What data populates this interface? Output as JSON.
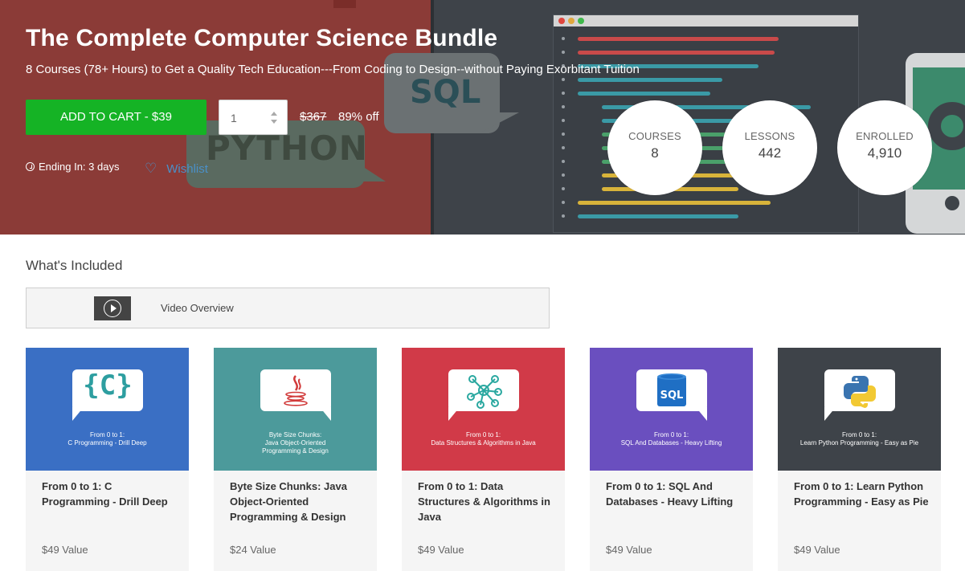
{
  "hero": {
    "title": "The Complete Computer Science Bundle",
    "subtitle": "8 Courses (78+ Hours) to Get a Quality Tech Education---From Coding to Design--without Paying Exorbitant Tuition",
    "cart_label": "ADD TO CART - $39",
    "quantity": "1",
    "old_price": "$367",
    "discount": "89% off",
    "ending": "Ending In: 3 days",
    "wishlist": "Wishlist",
    "bg_text_sql": "SQL",
    "bg_text_python": "PYTHON",
    "colors": {
      "hero_bg": "#8b3b37",
      "cart": "#15b325",
      "wishlist": "#4a90c8"
    }
  },
  "stats": [
    {
      "label": "COURSES",
      "value": "8"
    },
    {
      "label": "LESSONS",
      "value": "442"
    },
    {
      "label": "ENROLLED",
      "value": "4,910"
    }
  ],
  "included": {
    "title": "What's Included",
    "video_label": "Video Overview"
  },
  "courses": [
    {
      "icon": "c-language-icon",
      "color": "#3a6fc4",
      "caption": "From 0 to 1:\nC Programming - Drill Deep",
      "title": "From 0 to 1: C Programming - Drill Deep",
      "value": "$49 Value"
    },
    {
      "icon": "java-icon",
      "color": "#4c9a9b",
      "caption": "Byte Size Chunks:\nJava Object-Oriented\nProgramming & Design",
      "title": "Byte Size Chunks: Java Object-Oriented Programming & Design",
      "value": "$24 Value"
    },
    {
      "icon": "network-graph-icon",
      "color": "#d13a48",
      "caption": "From 0 to 1:\nData Structures & Algorithms in Java",
      "title": "From 0 to 1: Data Structures & Algorithms in Java",
      "value": "$49 Value"
    },
    {
      "icon": "sql-database-icon",
      "color": "#6a4fbf",
      "caption": "From 0 to 1:\nSQL And Databases - Heavy Lifting",
      "title": "From 0 to 1: SQL And Databases - Heavy Lifting",
      "value": "$49 Value"
    },
    {
      "icon": "python-icon",
      "color": "#3e4349",
      "caption": "From 0 to 1:\nLearn Python Programming - Easy as Pie",
      "title": "From 0 to 1: Learn Python Programming - Easy as Pie",
      "value": "$49 Value"
    }
  ]
}
